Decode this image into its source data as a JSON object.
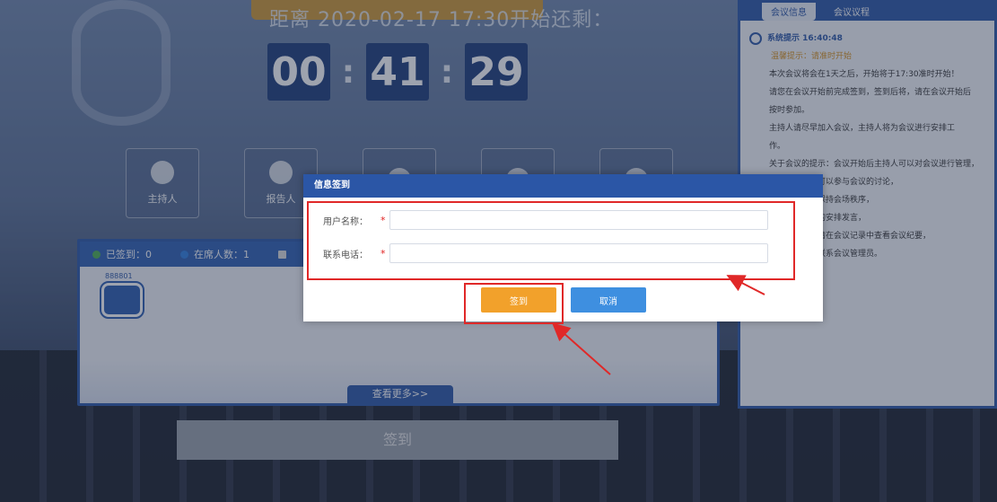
{
  "background": {
    "meeting_time_text": "距离 2020-02-17 17:30开始还剩：",
    "countdown": {
      "hours": "00",
      "minutes": "41",
      "seconds": "29",
      "separator": ":"
    },
    "roles": [
      {
        "label": "主持人",
        "icon": "host-icon"
      },
      {
        "label": "报告人",
        "icon": "reporter-icon"
      },
      {
        "label": "",
        "icon": "user-icon"
      },
      {
        "label": "",
        "icon": "user-icon"
      },
      {
        "label": "",
        "icon": "user-icon"
      }
    ],
    "seats": {
      "stats": [
        {
          "label": "已签到：0",
          "color": "#4caf50"
        },
        {
          "label": "在席人数：1",
          "color": "#2f7fe0"
        },
        {
          "label": "",
          "color": "#dddddd"
        }
      ],
      "seat_label": "888801",
      "view_more": "查看更多>>"
    },
    "signin_bar": "签到",
    "notice_panel": {
      "tabs": [
        "会议信息",
        "会议议程"
      ],
      "title": "系统提示 16:40:48",
      "subtitle": "温馨提示：请准时开始",
      "lines": [
        "本次会议将会在1天之后，开始将于17:30准时开始！",
        "请您在会议开始前完成签到，签到后将，请在会议开始后",
        "按时参加。",
        "主持人请尽早加入会议，主持人将为会议进行安排工",
        "作。",
        "关于会议的提示：会议开始后主持人可以对会议进行管理，",
        "人员签到后，可以参与会议的讨论，",
        "会议进行中请保持会场秩序，",
        "请按照主持人的安排发言，",
        "会议结束后，请在会议记录中查看会议纪要，",
        "如有疑问，请联系会议管理员。"
      ]
    }
  },
  "dialog": {
    "title": "信息签到",
    "fields": [
      {
        "label": "用户名称：",
        "required_mark": "*",
        "value": ""
      },
      {
        "label": "联系电话：",
        "required_mark": "*",
        "value": ""
      }
    ],
    "buttons": {
      "signin": "签到",
      "cancel": "取消"
    }
  },
  "colors": {
    "primary": "#2b56a6",
    "signin_button": "#f2a12b",
    "cancel_button": "#3e8fe0",
    "annotation": "#e02828"
  }
}
